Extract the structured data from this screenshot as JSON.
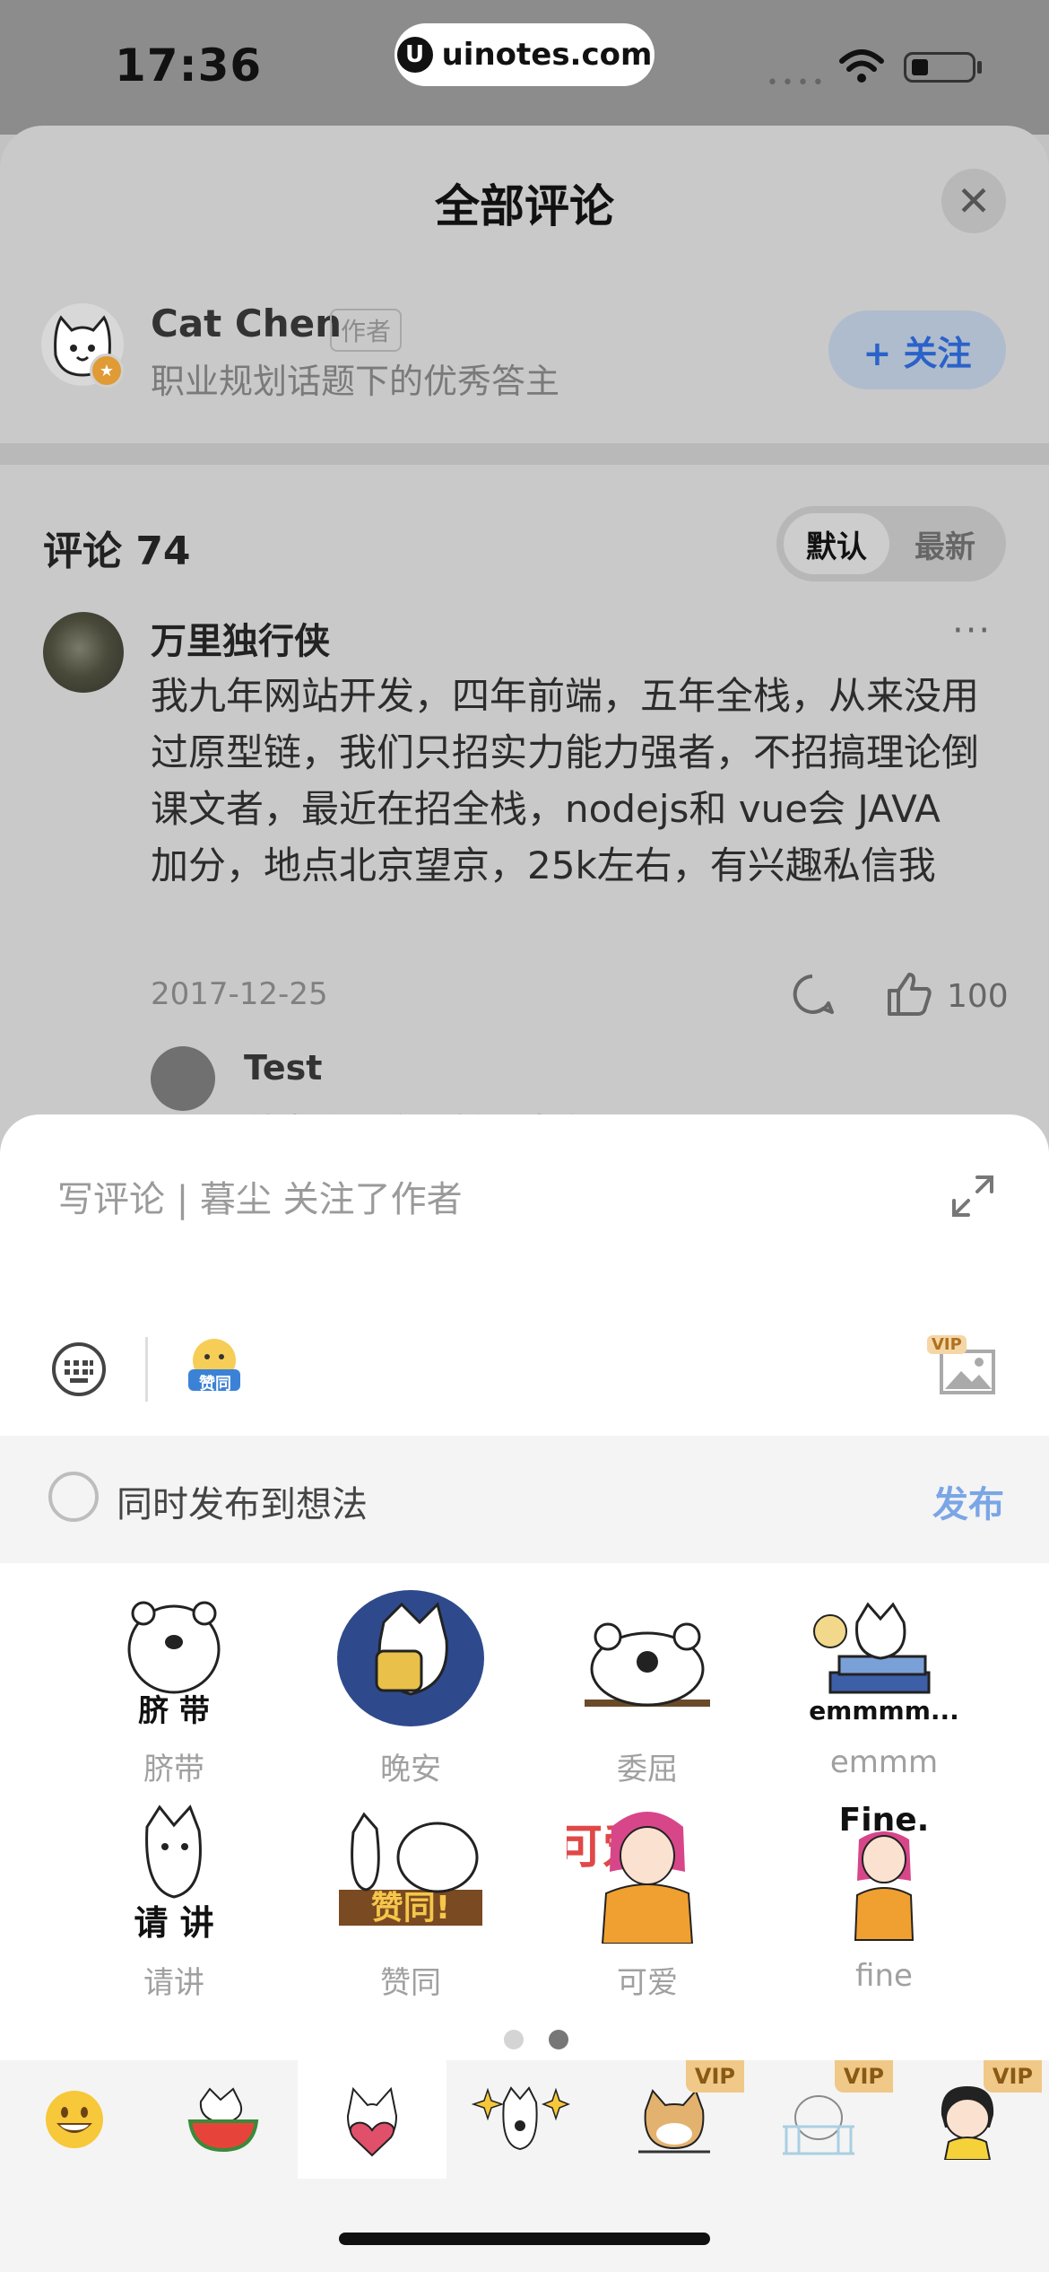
{
  "status_bar": {
    "time": "17:36",
    "watermark": "uinotes.com",
    "watermark_logo": "U"
  },
  "sheet": {
    "title": "全部评论",
    "close_glyph": "✕"
  },
  "author": {
    "name": "Cat Chen",
    "tag": "作者",
    "description": "职业规划话题下的优秀答主",
    "follow_label": "+ 关注"
  },
  "comments_header": {
    "count_label": "评论 74",
    "sort_default": "默认",
    "sort_latest": "最新"
  },
  "comment": {
    "author": "万里独行侠",
    "more": "···",
    "text": "我九年网站开发，四年前端，五年全栈，从来没用过原型链，我们只招实力能力强者，不招搞理论倒课文者，最近在招全栈，nodejs和 vue会 JAVA 加分，地点北京望京，25k左右，有兴趣私信我",
    "date": "2017-12-25",
    "likes": "100"
  },
  "reply": {
    "author": "Test",
    "text": "就喜欢你这果断下结论"
  },
  "editor": {
    "placeholder": "写评论 | 暮尘 关注了作者",
    "emoji_badge": "赞同",
    "vip_badge": "VIP"
  },
  "sync": {
    "label": "同时发布到想法",
    "publish": "发布"
  },
  "stickers": [
    {
      "label": "脐带",
      "caption": "脐 带"
    },
    {
      "label": "晚安",
      "caption": ""
    },
    {
      "label": "委屈",
      "caption": ""
    },
    {
      "label": "emmm",
      "caption": "emmmm..."
    },
    {
      "label": "请讲",
      "caption": "请 讲"
    },
    {
      "label": "赞同",
      "caption": "赞同!"
    },
    {
      "label": "可爱",
      "caption": "可爱"
    },
    {
      "label": "fine",
      "caption": "Fine."
    }
  ],
  "pager": {
    "pages": 2,
    "current": 2
  },
  "tabs": [
    {
      "name": "emoji",
      "vip": false
    },
    {
      "name": "watermelon-cat",
      "vip": false
    },
    {
      "name": "cat-heart",
      "vip": false,
      "active": true
    },
    {
      "name": "sparkle-cat",
      "vip": false
    },
    {
      "name": "shiba",
      "vip": true
    },
    {
      "name": "bear-crib",
      "vip": true
    },
    {
      "name": "girl",
      "vip": true
    }
  ],
  "vip_label": "VIP",
  "colors": {
    "accent": "#2a62c9",
    "publish": "#7aa6e6",
    "vip_bg": "#f0c887",
    "backdrop": "#c9c9c9"
  }
}
